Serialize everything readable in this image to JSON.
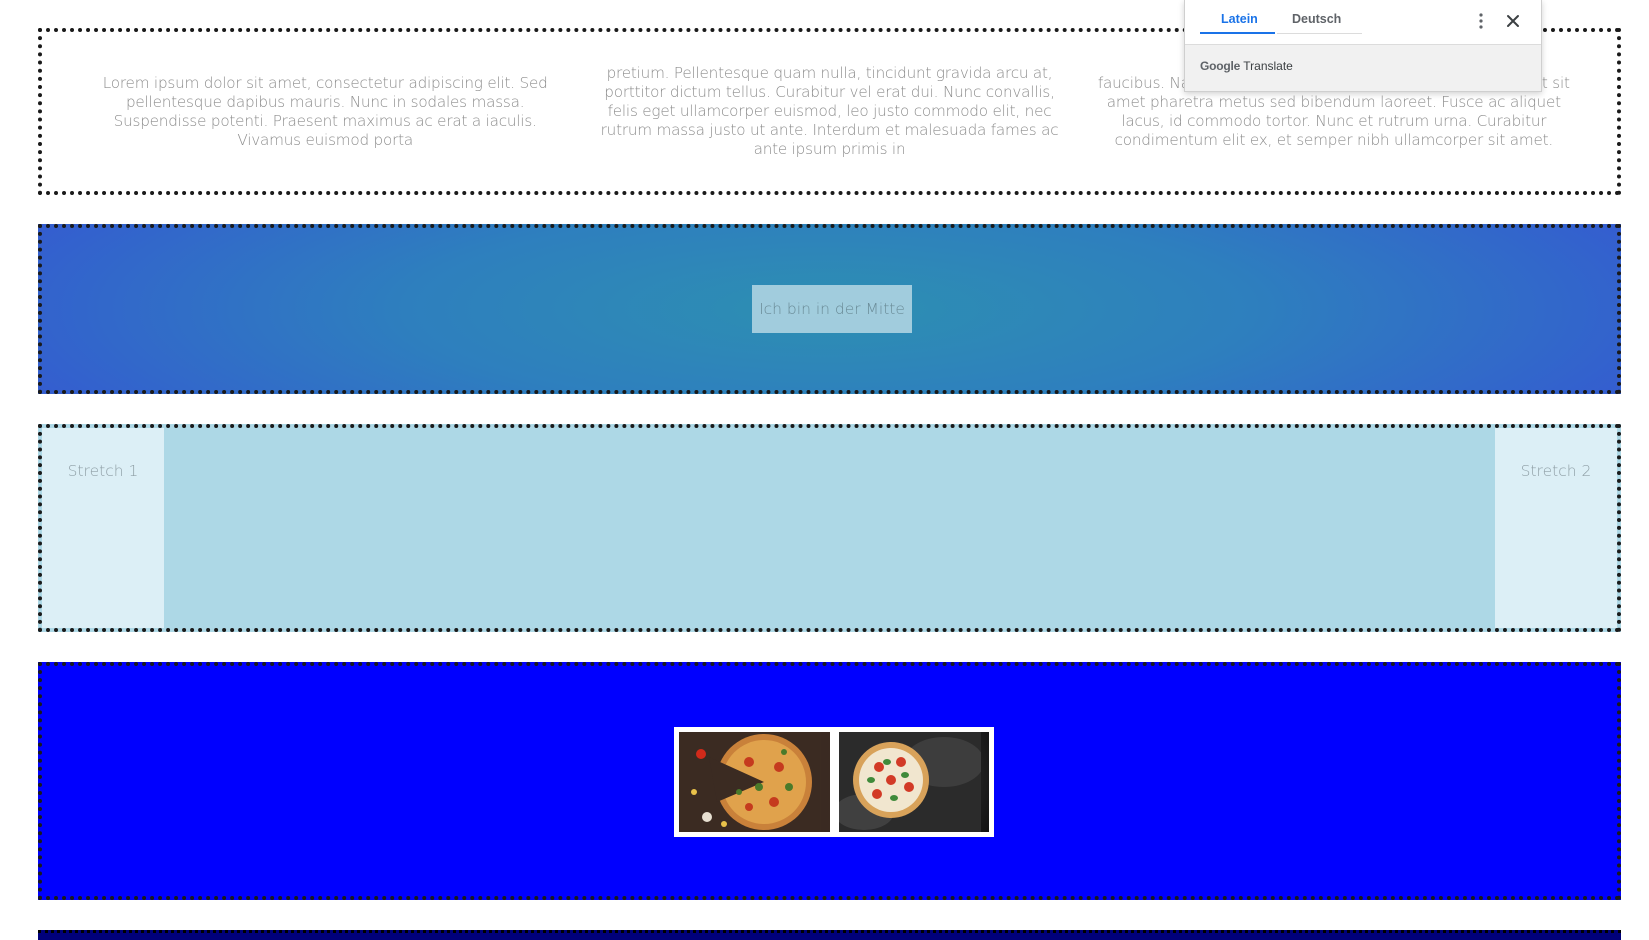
{
  "sections": {
    "text_columns": [
      "Lorem ipsum dolor sit amet, consectetur adipiscing elit. Sed pellentesque dapibus mauris. Nunc in sodales massa. Suspendisse potenti. Praesent maximus ac erat a iaculis. Vivamus euismod porta",
      "pretium. Pellentesque quam nulla, tincidunt gravida arcu at, porttitor dictum tellus. Curabitur vel erat dui. Nunc convallis, felis eget ullamcorper euismod, leo justo commodo elit, nec rutrum massa justo ut ante. Interdum et malesuada fames ac ante ipsum primis in",
      "faucibus. Nam ac ullamcorper diam, quis maximus quam. Ut sit amet pharetra metus sed bibendum laoreet. Fusce ac aliquet lacus, id commodo tortor. Nunc et rutrum urna. Curabitur condimentum elit ex, et semper nibh ullamcorper sit amet."
    ],
    "center_label": "Ich bin in der Mitte",
    "stretch_1": "Stretch 1",
    "stretch_2": "Stretch 2",
    "images": [
      "pizza-sliced",
      "pizza-margherita"
    ]
  },
  "colors": {
    "gradient_center": "#2d8fb2",
    "gradient_edge": "#3557d3",
    "stretch_bg": "#add8e6",
    "stretch_item_bg": "#dceff6",
    "images_bg": "#0000ff",
    "accent": "#1a73e8"
  },
  "translate_popup": {
    "tabs": [
      {
        "label": "Latein",
        "active": true
      },
      {
        "label": "Deutsch",
        "active": false
      }
    ],
    "brand_google": "Google",
    "brand_translate": "Translate",
    "icons": [
      "more-vert-icon",
      "close-icon"
    ]
  }
}
